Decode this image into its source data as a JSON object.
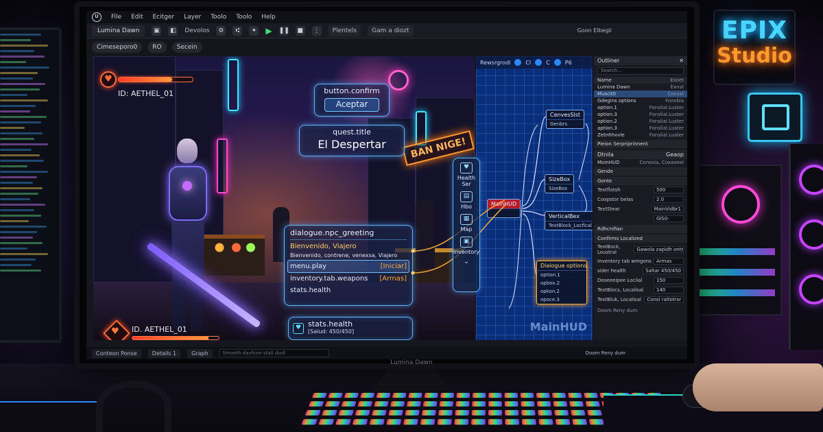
{
  "room": {
    "sign_line1": "EPIX",
    "sign_line2": "Studio"
  },
  "app": {
    "menu": [
      "File",
      "Edit",
      "Ecitger",
      "Layer",
      "Toolo",
      "Toolo",
      "Help"
    ],
    "project_tab": "Lumina Dawn",
    "toolbar_item": "Devolos",
    "toolbar_dropdown_1": "Plentels",
    "toolbar_dropdown_2": "Gam a diozt",
    "top_right_label": "Goon Elbegli",
    "viewport_pills": [
      "Cimeseporo0",
      "RO",
      "Secein"
    ],
    "monitor_brand": "Lumina Dawn"
  },
  "viewport": {
    "neon_sign": "BAN NIGE!",
    "hud_top": {
      "id": "ID: AETHEL_01",
      "health_fraction": 0.72
    },
    "button_card": {
      "key": "button.confirm",
      "label": "Aceptar"
    },
    "quest_card": {
      "key": "quest.title",
      "value": "El Despertar"
    },
    "dialog_card": {
      "key": "dialogue.npc_greeting",
      "greeting": "Bienvenido, Viajero",
      "subline": "Bienvenido, contrene, venexsa, Viajero",
      "items": [
        {
          "key": "menu.play",
          "tag": "[Iniciar]"
        },
        {
          "key": "inventory.tab.weapons",
          "tag": "[Armas]"
        },
        {
          "key": "stats.health",
          "tag": ""
        }
      ]
    },
    "stats_card": {
      "key": "stats.health",
      "value": "[Salud: 450/450]"
    },
    "hud_bottom": {
      "id": "ID. AETHEL_01",
      "health_fraction": 0.88
    },
    "side_nav": [
      {
        "label": "Health Ser",
        "icon": "♥"
      },
      {
        "label": "Hbo",
        "icon": "▤"
      },
      {
        "label": "Map",
        "icon": "▦"
      },
      {
        "label": "Inventory",
        "icon": "▣"
      }
    ]
  },
  "graph": {
    "header_label": "Rewsrgrodl",
    "header_tags": [
      "Cl",
      "C",
      "P6"
    ],
    "nodes": {
      "canvas": {
        "title": "CenvesSlst",
        "sub": "Genbrs"
      },
      "root": {
        "title": "MainHUD"
      },
      "size": {
        "title": "SizeBox",
        "sub": "SizeBox"
      },
      "vbox": {
        "title": "VerticalBex",
        "sub": "TextBlock_Locfical"
      },
      "options": {
        "title": "Dialogue options",
        "items": [
          "option.1",
          "opbox.2",
          "opkon.2",
          "opoce.3"
        ]
      }
    },
    "watermark": "MainHUD"
  },
  "outliner": {
    "title": "Outliner",
    "search": "Search...",
    "col_name": "Name",
    "col_type": "Exoet",
    "rows": [
      {
        "label": "Lumina Dawn",
        "type": "Exnst"
      },
      {
        "label": "Muscit0",
        "type": "Coxast"
      },
      {
        "label": "Gdegins options",
        "type": "Fonsbia"
      },
      {
        "label": "option.1",
        "type": "Fonslial.Luster"
      },
      {
        "label": "option.3",
        "type": "Fonslial.Luster"
      },
      {
        "label": "option.2",
        "type": "Fonslial.Luster"
      },
      {
        "label": "aption.3",
        "type": "Fonslial.Luster"
      },
      {
        "label": "Zetnhhvvle",
        "type": "Fonslial.Luster"
      }
    ],
    "footer": "Pieion Serpriprinnent"
  },
  "details": {
    "tabs": [
      "Dtnila",
      "Geaop"
    ],
    "widget": "MoinHUD",
    "widget_right": "Conosia, Coxaoeel",
    "section_1": "Gende",
    "section_2": "Gonte",
    "props_1": [
      {
        "label": "Textflotsh",
        "value": "500"
      },
      {
        "label": "Coopstor belas",
        "value": "2.0"
      },
      {
        "label": "TextStear",
        "value": "MainVidbr1"
      },
      {
        "label": "",
        "value": "GlS0-"
      }
    ],
    "section_3": "Rdhcnifian",
    "section_4": "Confirms Localized",
    "props_2": [
      {
        "label": "TextBock, Loustral",
        "value": "Gawola zapidh ontriar"
      },
      {
        "label": "Inventory tab wmgons",
        "value": "Armas"
      },
      {
        "label": "sider health",
        "value": "Saltar 450/450"
      },
      {
        "label": "Doseeeipee Loclial",
        "value": "150"
      },
      {
        "label": "TextBlocs, Localisal",
        "value": "140"
      },
      {
        "label": "TextBluk, Localisal",
        "value": "Consl raltotrsr"
      }
    ],
    "footer": "Doom Reny dum"
  },
  "bottom": {
    "tabs": [
      "Conteon Ponse",
      "Detalls 1",
      "Graph"
    ],
    "command_placeholder": "Smoeth davfcon stall dudl",
    "right_label": "Doom Reny dum"
  }
}
